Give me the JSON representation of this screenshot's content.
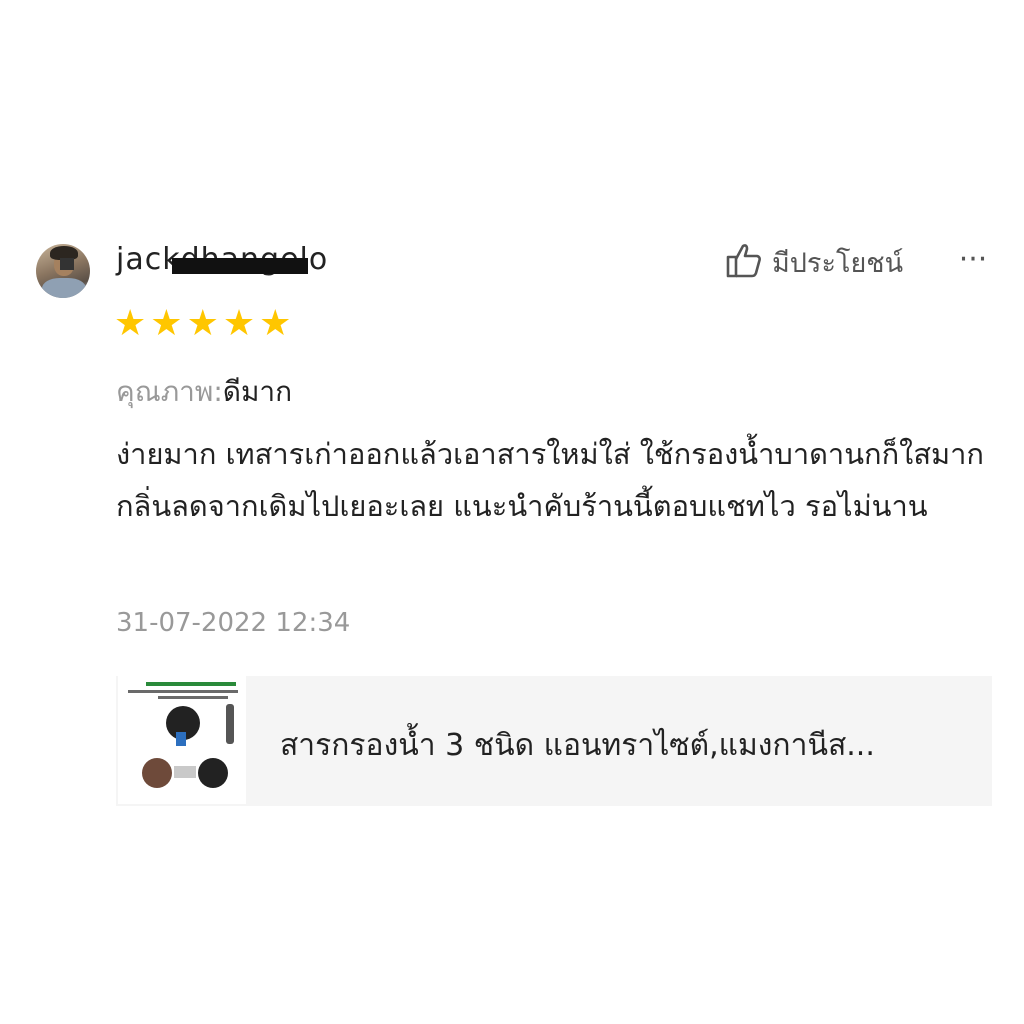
{
  "review": {
    "username": "jackdhangelo",
    "helpful_label": "มีประโยชน์",
    "more_label": "···",
    "rating": 5,
    "stars": [
      "★",
      "★",
      "★",
      "★",
      "★"
    ],
    "quality_label": "คุณภาพ:",
    "quality_value": "ดีมาก",
    "text": "ง่ายมาก เทสารเก่าออกแล้วเอาสารใหม่ใส่ ใช้กรองน้ำบาดานกก็ใสมาก กลิ่นลดจากเดิมไปเยอะเลย แนะนำคับร้านนี้ตอบแชทไว รอไม่นาน",
    "timestamp": "31-07-2022 12:34"
  },
  "product": {
    "title": "สารกรองน้ำ 3 ชนิด แอนทราไซต์,แมงกานีส..."
  },
  "colors": {
    "star": "#ffc600",
    "muted_text": "#999999",
    "card_bg": "#f5f5f5"
  },
  "icons": {
    "helpful": "thumbs-up-icon",
    "more": "more-icon"
  }
}
